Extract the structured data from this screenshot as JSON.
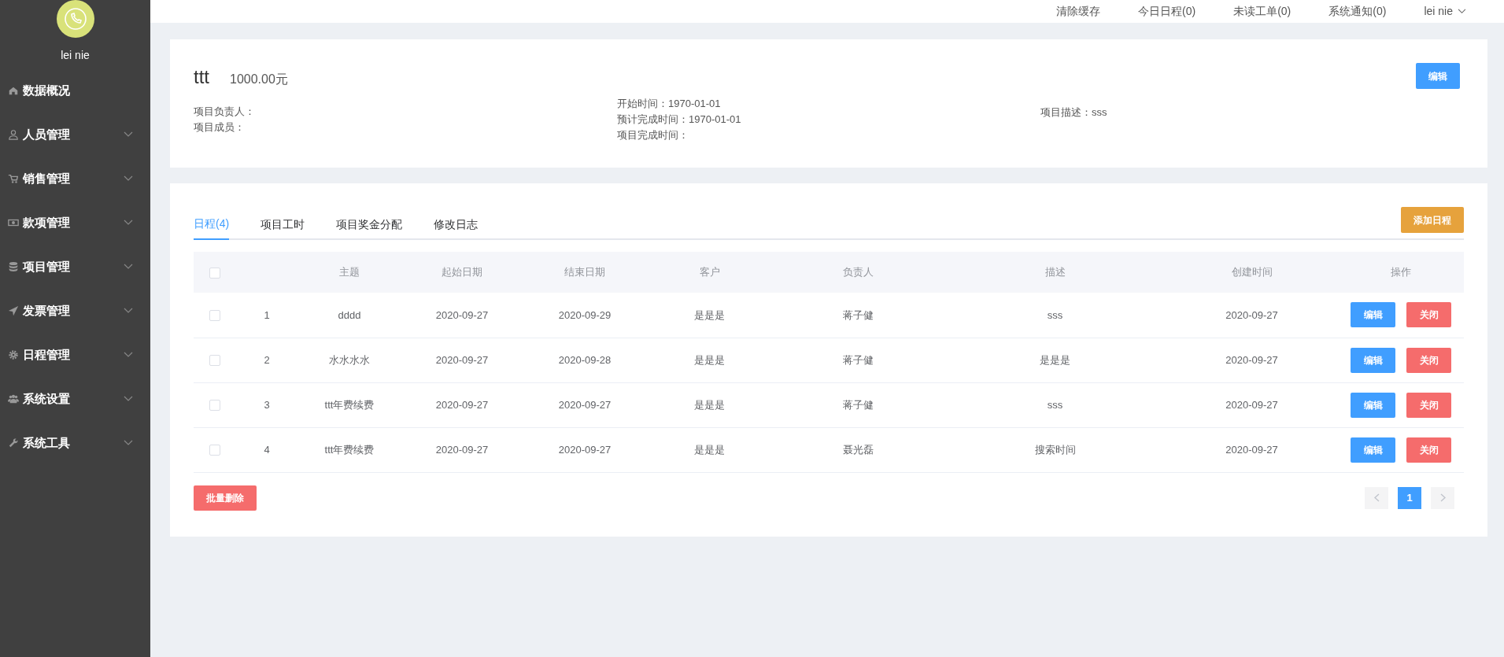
{
  "sidebar": {
    "user_name": "lei nie",
    "items": [
      {
        "label": "数据概况",
        "kind": "home",
        "expandable": false
      },
      {
        "label": "人员管理",
        "kind": "user",
        "expandable": true
      },
      {
        "label": "销售管理",
        "kind": "cart",
        "expandable": true
      },
      {
        "label": "款项管理",
        "kind": "money",
        "expandable": true
      },
      {
        "label": "项目管理",
        "kind": "database",
        "expandable": true
      },
      {
        "label": "发票管理",
        "kind": "send",
        "expandable": true
      },
      {
        "label": "日程管理",
        "kind": "gear",
        "expandable": true
      },
      {
        "label": "系统设置",
        "kind": "users",
        "expandable": true
      },
      {
        "label": "系统工具",
        "kind": "wrench",
        "expandable": true
      }
    ]
  },
  "top_bar": {
    "links": [
      "清除缓存",
      "今日日程(0)",
      "未读工单(0)",
      "系统通知(0)"
    ],
    "user_menu": "lei nie"
  },
  "project": {
    "title": "ttt",
    "amount": "1000.00元",
    "edit_button": "编辑",
    "fields": [
      [
        "项目负责人：",
        "项目成员："
      ],
      [
        "开始时间：1970-01-01",
        "预计完成时间：1970-01-01",
        "项目完成时间："
      ],
      [
        "项目描述：sss"
      ]
    ]
  },
  "tabs": [
    {
      "label": "日程(4)",
      "selected": true
    },
    {
      "label": "项目工时",
      "selected": false
    },
    {
      "label": "项目奖金分配",
      "selected": false
    },
    {
      "label": "修改日志",
      "selected": false
    }
  ],
  "add_button": "添加日程",
  "table": {
    "all_checked": false,
    "columns": [
      "",
      "主题",
      "起始日期",
      "结束日期",
      "客户",
      "负责人",
      "描述",
      "创建时间",
      "操作"
    ],
    "rows": [
      {
        "checked": false,
        "cells": [
          "1",
          "dddd",
          "2020-09-27",
          "2020-09-29",
          "是是是",
          "蒋子健",
          "sss",
          "2020-09-27"
        ],
        "actions": [
          "编辑",
          "关闭"
        ]
      },
      {
        "checked": false,
        "cells": [
          "2",
          "水水水水",
          "2020-09-27",
          "2020-09-28",
          "是是是",
          "蒋子健",
          "是是是",
          "2020-09-27"
        ],
        "actions": [
          "编辑",
          "关闭"
        ]
      },
      {
        "checked": false,
        "cells": [
          "3",
          "ttt年费续费",
          "2020-09-27",
          "2020-09-27",
          "是是是",
          "蒋子健",
          "sss",
          "2020-09-27"
        ],
        "actions": [
          "编辑",
          "关闭"
        ]
      },
      {
        "checked": false,
        "cells": [
          "4",
          "ttt年费续费",
          "2020-09-27",
          "2020-09-27",
          "是是是",
          "聂光磊",
          "搜索时间",
          "2020-09-27"
        ],
        "actions": [
          "编辑",
          "关闭"
        ]
      }
    ]
  },
  "batch_delete": "批量删除",
  "pagination": {
    "pages": [
      {
        "label": "1",
        "selected": true
      }
    ]
  }
}
